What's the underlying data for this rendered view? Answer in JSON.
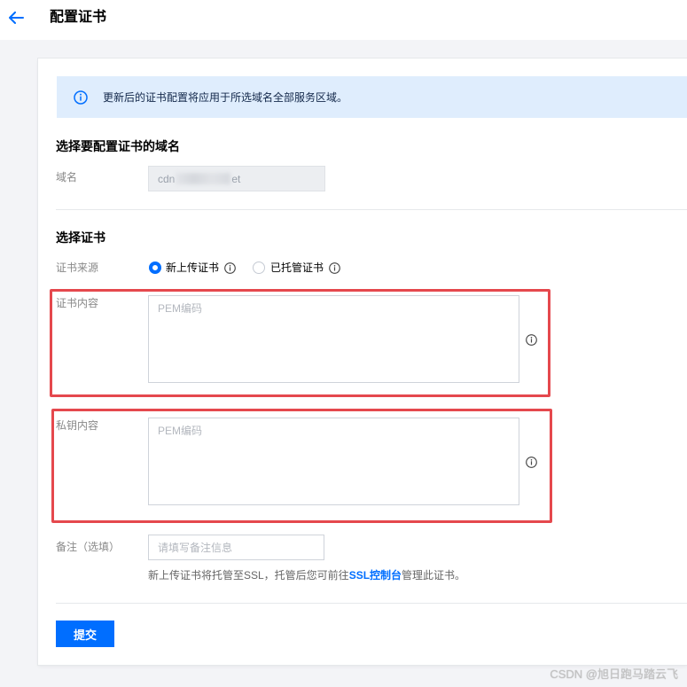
{
  "header": {
    "back_icon": "arrow-left-icon",
    "title": "配置证书"
  },
  "colors": {
    "accent": "#006eff",
    "annotation": "#e5484d",
    "alert_background": "#dfedfd"
  },
  "alert": {
    "icon": "info-circle-icon",
    "text": "更新后的证书配置将应用于所选域名全部服务区域。"
  },
  "domain_section": {
    "title": "选择要配置证书的域名",
    "domain_label": "域名",
    "domain_value_prefix": "cdn",
    "domain_value_suffix": "et"
  },
  "cert_section": {
    "title": "选择证书",
    "source_label": "证书来源",
    "source_options": [
      {
        "label": "新上传证书",
        "selected": true,
        "info_icon": "info-circle-icon"
      },
      {
        "label": "已托管证书",
        "selected": false,
        "info_icon": "info-circle-icon"
      }
    ],
    "certificate_content": {
      "label": "证书内容",
      "placeholder": "PEM编码",
      "info_icon": "info-circle-icon"
    },
    "private_key_content": {
      "label": "私钥内容",
      "placeholder": "PEM编码",
      "info_icon": "info-circle-icon"
    },
    "remark": {
      "label": "备注（选填）",
      "placeholder": "请填写备注信息"
    },
    "help": {
      "text_before": "新上传证书将托管至SSL，托管后您可前往",
      "link": "SSL控制台",
      "text_after": "管理此证书。"
    }
  },
  "actions": {
    "submit_label": "提交"
  },
  "watermark": "CSDN @旭日跑马踏云飞"
}
